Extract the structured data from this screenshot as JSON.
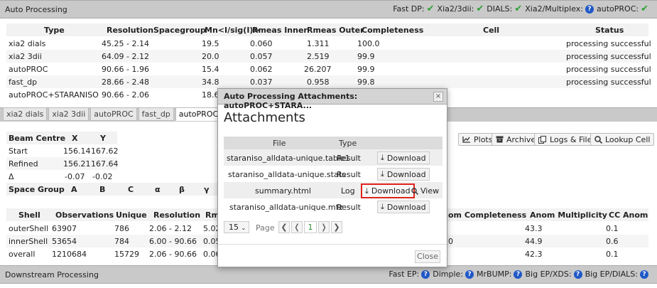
{
  "top_bar": {
    "title": "Auto Processing",
    "items": [
      {
        "label": "Fast DP:",
        "status": "ok"
      },
      {
        "label": "Xia2/3dii:",
        "status": "ok"
      },
      {
        "label": "DIALS:",
        "status": "ok"
      },
      {
        "label": "Xia2/Multiplex:",
        "status": "question"
      },
      {
        "label": "autoPROC:",
        "status": "ok"
      }
    ]
  },
  "summary_table": {
    "headers": [
      "Type",
      "Resolution",
      "Spacegroup",
      "Mn<I/sig(I)>",
      "Rmeas Inner",
      "Rmeas Outer",
      "Completeness",
      "Cell",
      "Status"
    ],
    "rows": [
      [
        "xia2 dials",
        "45.25 - 2.14",
        "",
        "19.5",
        "0.060",
        "1.311",
        "100.0",
        "",
        "processing successful"
      ],
      [
        "xia2 3dii",
        "64.09 - 2.12",
        "",
        "20.0",
        "0.057",
        "2.519",
        "99.9",
        "",
        "processing successful"
      ],
      [
        "autoPROC",
        "90.66 - 1.96",
        "",
        "15.4",
        "0.062",
        "26.207",
        "99.9",
        "",
        "processing successful"
      ],
      [
        "fast_dp",
        "28.66 - 2.48",
        "",
        "34.8",
        "0.037",
        "0.958",
        "99.8",
        "",
        "processing successful"
      ],
      [
        "autoPROC+STARANISO",
        "90.66 - 2.06",
        "",
        "18.6",
        "",
        "",
        "",
        "",
        ""
      ]
    ]
  },
  "tabs": [
    "xia2 dials",
    "xia2 3dii",
    "autoPROC",
    "fast_dp",
    "autoPROC+STARANISO"
  ],
  "toolbar": {
    "plots": "Plots",
    "archive": "Archive",
    "logs": "Logs & Files",
    "lookup": "Lookup Cell"
  },
  "beam_centre": {
    "headers": [
      "Beam Centre",
      "X",
      "Y"
    ],
    "rows": [
      [
        "Start",
        "156.14",
        "167.62"
      ],
      [
        "Refined",
        "156.21",
        "167.64"
      ],
      [
        "Δ",
        "-0.07",
        "-0.02"
      ]
    ]
  },
  "space_group": {
    "headers": [
      "Space Group",
      "A",
      "B",
      "C",
      "α",
      "β",
      "γ"
    ]
  },
  "shell_table": {
    "headers": [
      "Shell",
      "Observations",
      "Unique",
      "Resolution",
      "Rm"
    ],
    "right_headers": [
      "om Completeness",
      "Anom Multiplicity",
      "CC Anom"
    ],
    "rows": [
      [
        "outerShell",
        "63907",
        "786",
        "2.06 - 2.12",
        "5.02",
        "",
        "43.3",
        "0.1"
      ],
      [
        "innerShell",
        "53654",
        "784",
        "6.00 - 90.66",
        "0.05",
        "0",
        "44.9",
        "0.6"
      ],
      [
        "overall",
        "1210684",
        "15729",
        "2.06 - 90.66",
        "0.06",
        "",
        "42.3",
        "0.1"
      ]
    ]
  },
  "bottom_bar": {
    "title": "Downstream Processing",
    "items": [
      {
        "label": "Fast EP:",
        "status": "question"
      },
      {
        "label": "Dimple:",
        "status": "question"
      },
      {
        "label": "MrBUMP:",
        "status": "question"
      },
      {
        "label": "Big EP/XDS:",
        "status": "question"
      },
      {
        "label": "Big EP/DIALS:",
        "status": "question"
      }
    ]
  },
  "modal": {
    "title": "Auto Processing Attachments: autoPROC+STARA...",
    "close_x": "×",
    "heading": "Attachments",
    "headers": {
      "file": "File",
      "type": "Type"
    },
    "rows": [
      {
        "file": "staraniso_alldata-unique.table1",
        "type": "Result",
        "download": "Download",
        "view": ""
      },
      {
        "file": "staraniso_alldata-unique.stats",
        "type": "Result",
        "download": "Download",
        "view": ""
      },
      {
        "file": "summary.html",
        "type": "Log",
        "download": "Download",
        "view": "View"
      },
      {
        "file": "staraniso_alldata-unique.mtz",
        "type": "Result",
        "download": "Download",
        "view": ""
      }
    ],
    "per_page": "15",
    "page_label": "Page",
    "page_first": "❮",
    "page_prev": "❬",
    "current_page": "1",
    "page_next": "❭",
    "page_last": "❯",
    "close_button": "Close"
  }
}
